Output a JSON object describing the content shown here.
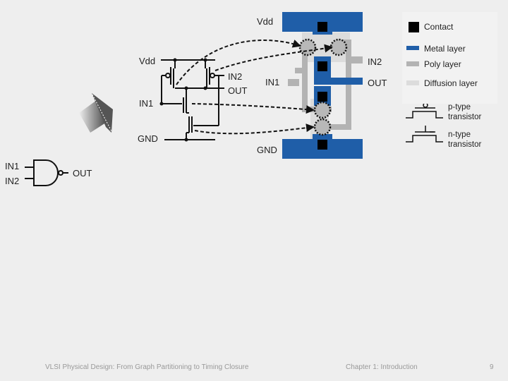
{
  "layout_labels": {
    "vdd": "Vdd",
    "in2": "IN2",
    "in1": "IN1",
    "out": "OUT",
    "gnd": "GND"
  },
  "schematic_labels": {
    "vdd": "Vdd",
    "in2": "IN2",
    "out": "OUT",
    "in1": "IN1",
    "gnd": "GND"
  },
  "gate_symbol": {
    "type": "NAND",
    "in1": "IN1",
    "in2": "IN2",
    "out": "OUT"
  },
  "legend": {
    "items": [
      {
        "label": "Contact",
        "color": "#000000"
      },
      {
        "label": "Metal layer",
        "color": "#1f5ea8"
      },
      {
        "label": "Poly layer",
        "color": "#b3b3b3"
      },
      {
        "label": "Diffusion layer",
        "color": "#dcdcdc"
      }
    ],
    "symbols": [
      {
        "label_line1": "p-type",
        "label_line2": "transistor"
      },
      {
        "label_line1": "n-type",
        "label_line2": "transistor"
      }
    ]
  },
  "footer": {
    "left": "VLSI Physical Design: From Graph Partitioning to Timing Closure",
    "center": "Chapter 1: Introduction",
    "page": "9"
  }
}
